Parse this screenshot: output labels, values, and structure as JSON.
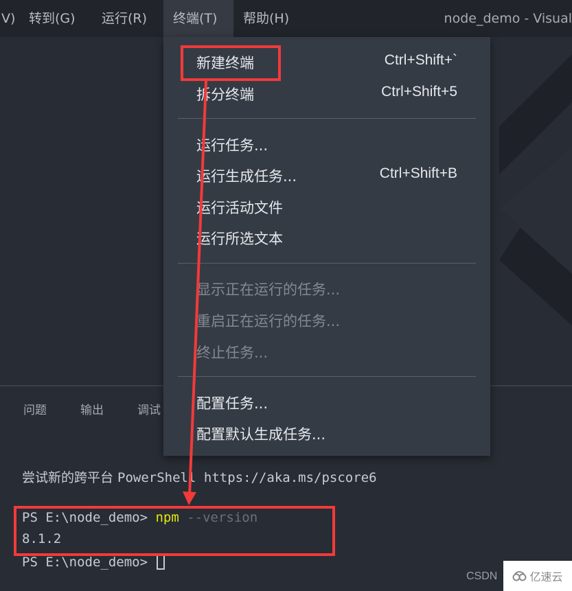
{
  "menubar": {
    "items": [
      {
        "label": "V)",
        "active": false
      },
      {
        "label": "转到(G)",
        "active": false
      },
      {
        "label": "运行(R)",
        "active": false
      },
      {
        "label": "终端(T)",
        "active": true
      },
      {
        "label": "帮助(H)",
        "active": false
      }
    ],
    "window_title": "node_demo - Visual"
  },
  "terminal_menu": {
    "groups": [
      [
        {
          "label": "新建终端",
          "shortcut": "Ctrl+Shift+`",
          "enabled": true,
          "highlighted": true
        },
        {
          "label": "拆分终端",
          "shortcut": "Ctrl+Shift+5",
          "enabled": true
        }
      ],
      [
        {
          "label": "运行任务...",
          "shortcut": "",
          "enabled": true
        },
        {
          "label": "运行生成任务...",
          "shortcut": "Ctrl+Shift+B",
          "enabled": true
        },
        {
          "label": "运行活动文件",
          "shortcut": "",
          "enabled": true
        },
        {
          "label": "运行所选文本",
          "shortcut": "",
          "enabled": true
        }
      ],
      [
        {
          "label": "显示正在运行的任务...",
          "shortcut": "",
          "enabled": false
        },
        {
          "label": "重启正在运行的任务...",
          "shortcut": "",
          "enabled": false
        },
        {
          "label": "终止任务...",
          "shortcut": "",
          "enabled": false
        }
      ],
      [
        {
          "label": "配置任务...",
          "shortcut": "",
          "enabled": true
        },
        {
          "label": "配置默认生成任务...",
          "shortcut": "",
          "enabled": true
        }
      ]
    ]
  },
  "panel": {
    "tabs": [
      "问题",
      "输出",
      "调试"
    ]
  },
  "terminal": {
    "banner_cjk": "尝试新的跨平台 ",
    "banner_rest": "PowerShell https://aka.ms/pscore6",
    "prompt": "PS E:\\node_demo> ",
    "command": "npm",
    "argument": " --version",
    "output": "8.1.2",
    "prompt2": "PS E:\\node_demo> "
  },
  "watermarks": {
    "csdn": "CSDN",
    "yisu": "亿速云"
  },
  "colors": {
    "annotation_red": "#f23a3a",
    "npm_yellow": "#e5e510",
    "menu_bg": "#353b45"
  }
}
